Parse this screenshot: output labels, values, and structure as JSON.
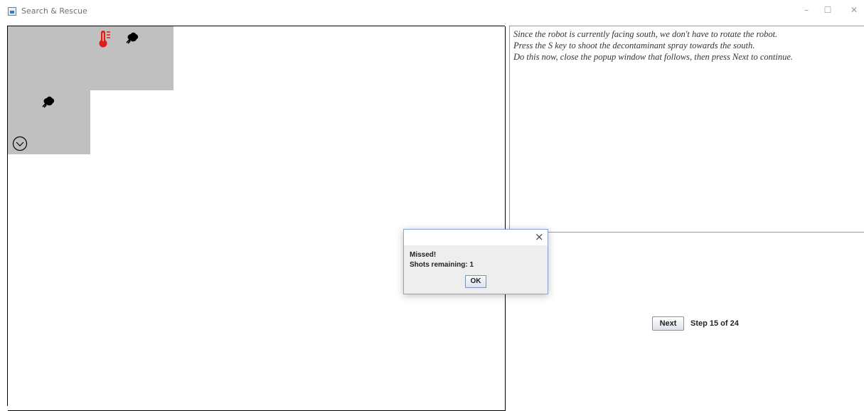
{
  "window": {
    "title": "Search & Rescue",
    "controls": {
      "minimize": "–",
      "maximize": "☐",
      "close": "✕"
    }
  },
  "grid": {
    "rows": 6,
    "cols": 6,
    "visited_cells": [
      "0-0",
      "0-1",
      "1-0"
    ],
    "icons": [
      {
        "cell": "0-1",
        "name": "thermometer-icon",
        "color": "#e11a1a"
      },
      {
        "cell": "0-1",
        "name": "debris-icon",
        "color": "#000000"
      },
      {
        "cell": "1-0",
        "name": "debris-icon",
        "color": "#000000"
      },
      {
        "cell": "1-0",
        "name": "robot-facing-south-icon",
        "color": "#000000"
      }
    ]
  },
  "instructions": {
    "lines": [
      "Since the robot is currently facing south, we don't have to rotate the robot.",
      "Press the S key to shoot the decontaminant spray towards the south.",
      "Do this now, close the popup window that follows, then press Next to continue."
    ]
  },
  "controls": {
    "next_label": "Next",
    "step_label": "Step 15 of 24"
  },
  "dialog": {
    "close_glyph": "×",
    "message_line_1": "Missed!",
    "message_line_2": "Shots remaining: 1",
    "ok_label": "OK"
  },
  "colors": {
    "visited_cell": "#c0c0c0",
    "grid_line": "#000000",
    "thermometer": "#e11a1a"
  }
}
